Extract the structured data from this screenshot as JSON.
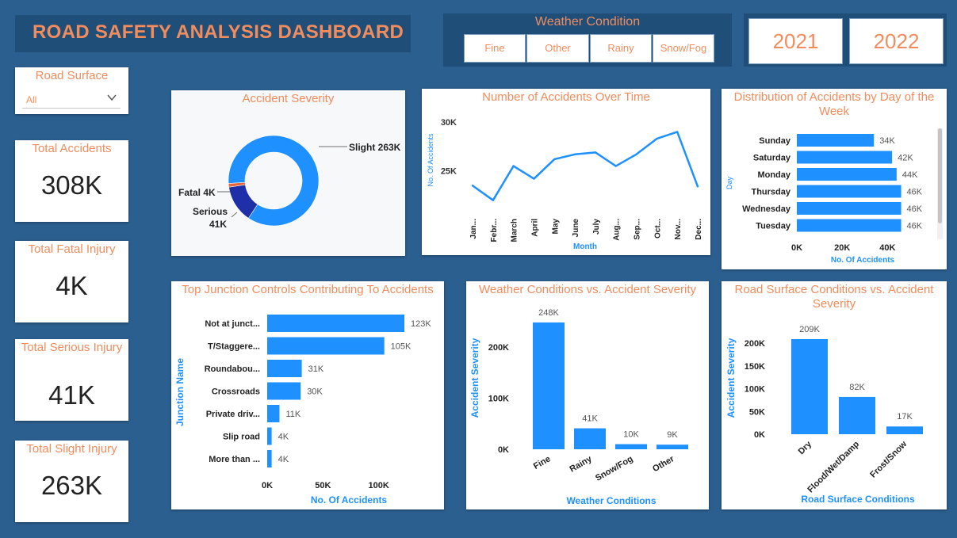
{
  "header": {
    "title": "ROAD SAFETY ANALYSIS DASHBOARD"
  },
  "weather_slicer": {
    "title": "Weather Condition",
    "options": [
      "Fine",
      "Other",
      "Rainy",
      "Snow/Fog"
    ]
  },
  "year_slicer": {
    "options": [
      "2021",
      "2022"
    ]
  },
  "road_surface_slicer": {
    "title": "Road Surface",
    "value": "All"
  },
  "kpis": [
    {
      "title": "Total Accidents",
      "value": "308K"
    },
    {
      "title": "Total Fatal Injury",
      "value": "4K"
    },
    {
      "title": "Total Serious Injury",
      "value": "41K"
    },
    {
      "title": "Total Slight Injury",
      "value": "263K"
    }
  ],
  "colors": {
    "accent": "#f28c5c",
    "bar": "#1e90ff",
    "dark_blue": "#1f2fa8",
    "fatal": "#e8663c",
    "background": "#2b5f8f"
  },
  "chart_data": [
    {
      "id": "severity",
      "type": "pie",
      "title": "Accident Severity",
      "categories": [
        "Slight",
        "Serious",
        "Fatal"
      ],
      "values": [
        263,
        41,
        4
      ],
      "labels": [
        "Slight 263K",
        "Serious 41K",
        "Fatal 4K"
      ],
      "colors": [
        "#1e90ff",
        "#1f2fa8",
        "#e8663c"
      ],
      "hole": true
    },
    {
      "id": "overtime",
      "type": "line",
      "title": "Number of Accidents Over Time",
      "xlabel": "Month",
      "ylabel": "No. Of Accidents",
      "categories": [
        "Jan...",
        "Febr...",
        "March",
        "April",
        "May",
        "June",
        "July",
        "Aug...",
        "Sep...",
        "Oct...",
        "Nov...",
        "Dec..."
      ],
      "values": [
        23500,
        22000,
        25500,
        24200,
        26200,
        26700,
        26900,
        25500,
        26700,
        28300,
        29000,
        23400
      ],
      "ylim": [
        20000,
        31000
      ],
      "yticks": [
        20000,
        25000,
        30000
      ],
      "ytick_labels": [
        "20K",
        "25K",
        "30K"
      ]
    },
    {
      "id": "dayofweek",
      "type": "bar",
      "orientation": "horizontal",
      "title": "Distribution of Accidents by Day of the Week",
      "xlabel": "No. Of Accidents",
      "ylabel": "Day",
      "categories": [
        "Sunday",
        "Saturday",
        "Monday",
        "Thursday",
        "Wednesday",
        "Tuesday"
      ],
      "values": [
        34,
        42,
        44,
        46,
        46,
        46
      ],
      "labels": [
        "34K",
        "42K",
        "44K",
        "46K",
        "46K",
        "46K"
      ],
      "xlim": [
        0,
        50
      ],
      "xticks": [
        0,
        20,
        40
      ],
      "xtick_labels": [
        "0K",
        "20K",
        "40K"
      ]
    },
    {
      "id": "junction",
      "type": "bar",
      "orientation": "horizontal",
      "title": "Top Junction Controls Contributing To Accidents",
      "xlabel": "No. Of Accidents",
      "ylabel": "Junction Name",
      "categories": [
        "Not at junct...",
        "T/Staggere...",
        "Roundabou...",
        "Crossroads",
        "Private driv...",
        "Slip road",
        "More than ..."
      ],
      "values": [
        123,
        105,
        31,
        30,
        11,
        4,
        4
      ],
      "labels": [
        "123K",
        "105K",
        "31K",
        "30K",
        "11K",
        "4K",
        "4K"
      ],
      "xlim": [
        0,
        140
      ],
      "xticks": [
        0,
        50,
        100
      ],
      "xtick_labels": [
        "0K",
        "50K",
        "100K"
      ]
    },
    {
      "id": "weather",
      "type": "bar",
      "orientation": "vertical",
      "title": "Weather Conditions vs. Accident Severity",
      "xlabel": "Weather Conditions",
      "ylabel": "Accident Severity",
      "categories": [
        "Fine",
        "Rainy",
        "Snow/Fog",
        "Other"
      ],
      "values": [
        248,
        41,
        10,
        9
      ],
      "labels": [
        "248K",
        "41K",
        "10K",
        "9K"
      ],
      "ylim": [
        0,
        248
      ],
      "yticks": [
        0,
        100,
        200
      ],
      "ytick_labels": [
        "0K",
        "100K",
        "200K"
      ]
    },
    {
      "id": "surface",
      "type": "bar",
      "orientation": "vertical",
      "title": "Road Surface Conditions vs. Accident Severity",
      "xlabel": "Road Surface Conditions",
      "ylabel": "Accident Severity",
      "categories": [
        "Dry",
        "Flood/Wet/Damp",
        "Frost/Snow"
      ],
      "values": [
        209,
        82,
        17
      ],
      "labels": [
        "209K",
        "82K",
        "17K"
      ],
      "ylim": [
        0,
        209
      ],
      "yticks": [
        0,
        50,
        100,
        150,
        200
      ],
      "ytick_labels": [
        "0K",
        "50K",
        "100K",
        "150K",
        "200K"
      ]
    }
  ]
}
